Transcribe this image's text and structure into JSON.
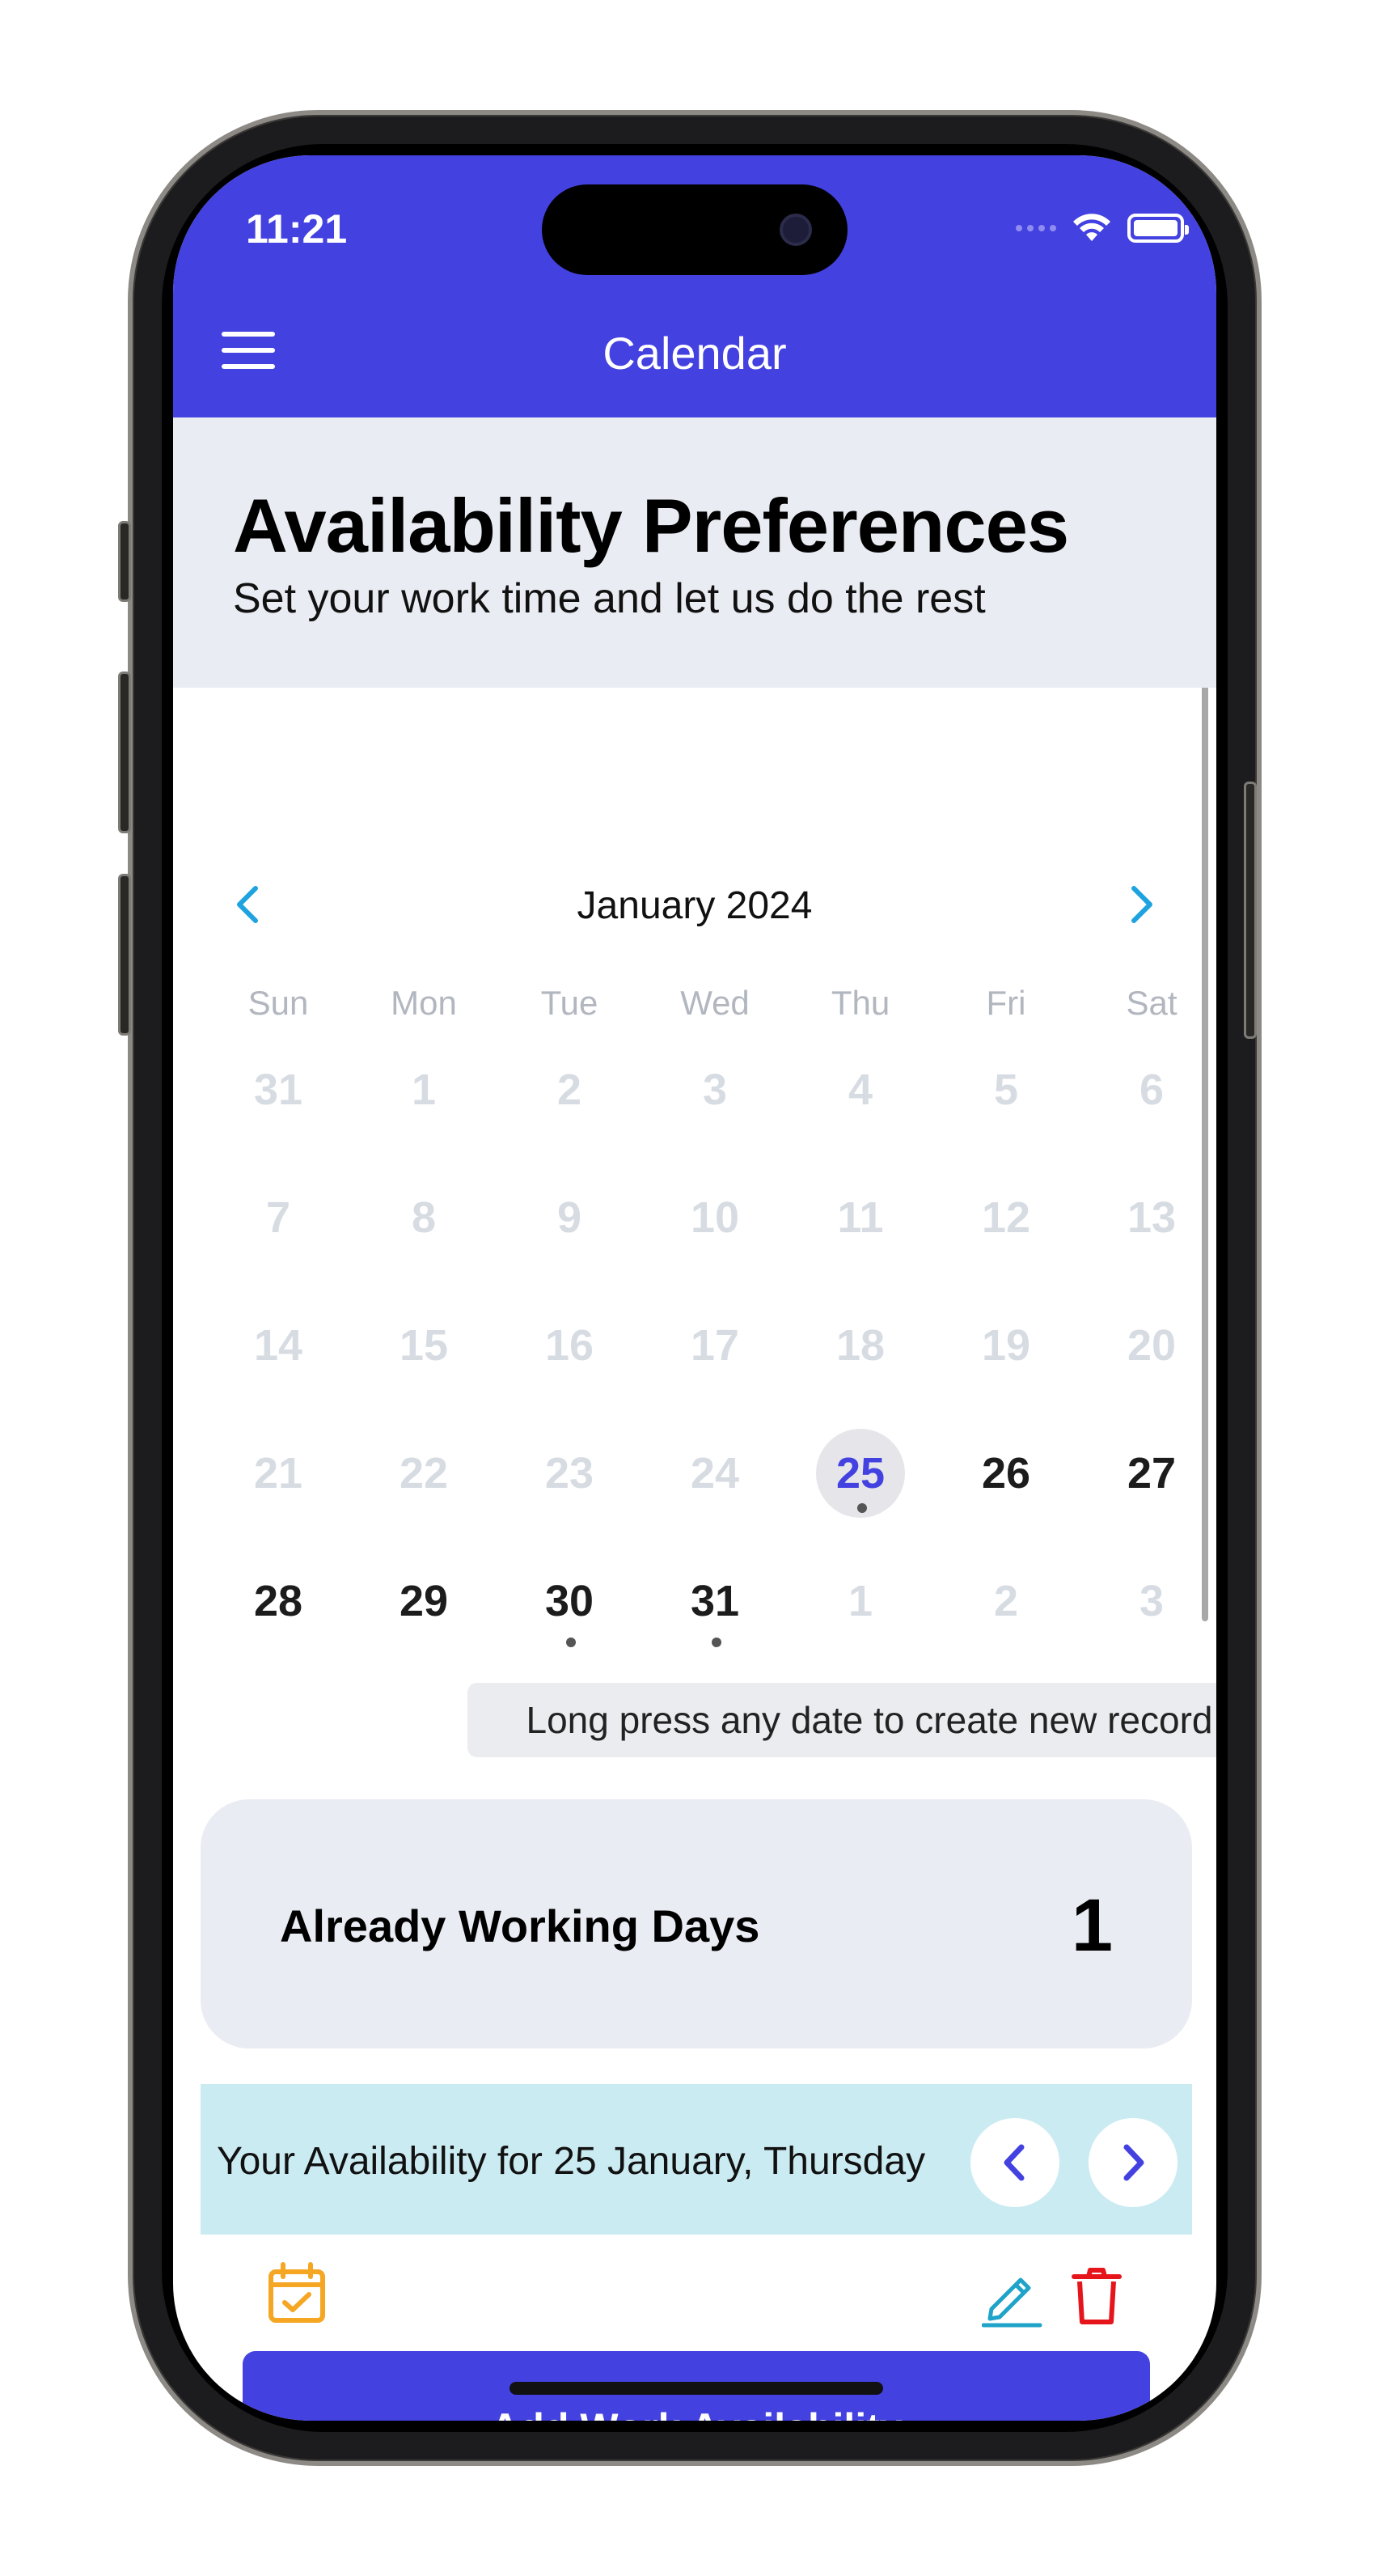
{
  "status_bar": {
    "time": "11:21"
  },
  "header": {
    "title": "Calendar",
    "menu_icon": "hamburger-menu-icon"
  },
  "hero": {
    "title": "Availability Preferences",
    "subtitle": "Set your work time and let us do the rest"
  },
  "calendar": {
    "month_label": "January 2024",
    "weekdays": [
      "Sun",
      "Mon",
      "Tue",
      "Wed",
      "Thu",
      "Fri",
      "Sat"
    ],
    "weeks": [
      [
        {
          "d": "31",
          "s": "out"
        },
        {
          "d": "1",
          "s": "past"
        },
        {
          "d": "2",
          "s": "past"
        },
        {
          "d": "3",
          "s": "past"
        },
        {
          "d": "4",
          "s": "past"
        },
        {
          "d": "5",
          "s": "past"
        },
        {
          "d": "6",
          "s": "past"
        }
      ],
      [
        {
          "d": "7",
          "s": "past"
        },
        {
          "d": "8",
          "s": "past"
        },
        {
          "d": "9",
          "s": "past"
        },
        {
          "d": "10",
          "s": "past"
        },
        {
          "d": "11",
          "s": "past"
        },
        {
          "d": "12",
          "s": "past"
        },
        {
          "d": "13",
          "s": "past"
        }
      ],
      [
        {
          "d": "14",
          "s": "past"
        },
        {
          "d": "15",
          "s": "past"
        },
        {
          "d": "16",
          "s": "past"
        },
        {
          "d": "17",
          "s": "past"
        },
        {
          "d": "18",
          "s": "past"
        },
        {
          "d": "19",
          "s": "past"
        },
        {
          "d": "20",
          "s": "past"
        }
      ],
      [
        {
          "d": "21",
          "s": "past"
        },
        {
          "d": "22",
          "s": "past"
        },
        {
          "d": "23",
          "s": "past"
        },
        {
          "d": "24",
          "s": "past"
        },
        {
          "d": "25",
          "s": "selected",
          "dot": true
        },
        {
          "d": "26",
          "s": "current"
        },
        {
          "d": "27",
          "s": "current"
        }
      ],
      [
        {
          "d": "28",
          "s": "current"
        },
        {
          "d": "29",
          "s": "current"
        },
        {
          "d": "30",
          "s": "current",
          "dot": true
        },
        {
          "d": "31",
          "s": "current",
          "dot": true
        },
        {
          "d": "1",
          "s": "out"
        },
        {
          "d": "2",
          "s": "out"
        },
        {
          "d": "3",
          "s": "out"
        }
      ]
    ],
    "hint": "Long press any date to create new record"
  },
  "working_days": {
    "label": "Already Working Days",
    "count": "1"
  },
  "availability": {
    "text": "Your Availability for 25 January, Thursday"
  },
  "actions": {
    "add_label": "Add Work Availability"
  },
  "colors": {
    "brand": "#4441e1",
    "calendar_icon": "#f5a623",
    "edit_icon": "#1fa3c9",
    "delete_icon": "#e5151b",
    "nav_chevron": "#1fa3e0"
  }
}
